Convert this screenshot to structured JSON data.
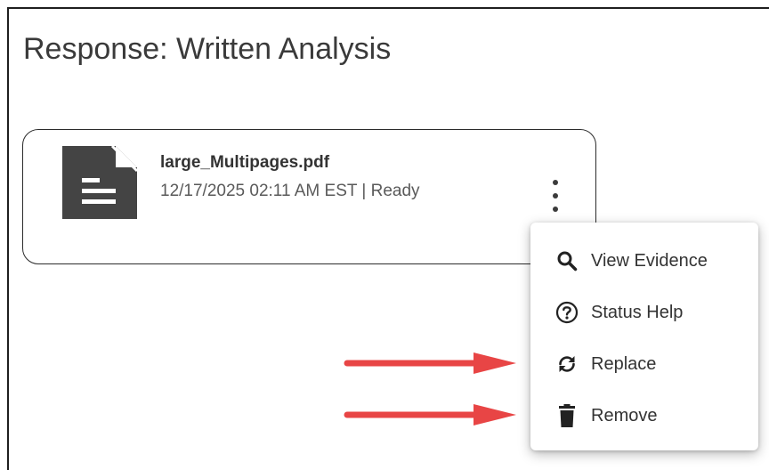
{
  "page": {
    "title": "Response: Written Analysis"
  },
  "file": {
    "name": "large_Multipages.pdf",
    "meta": "12/17/2025 02:11 AM EST | Ready",
    "icon": "document-icon"
  },
  "menu": {
    "items": [
      {
        "label": "View Evidence",
        "icon": "search-icon"
      },
      {
        "label": "Status Help",
        "icon": "help-circle-icon"
      },
      {
        "label": "Replace",
        "icon": "replace-sync-icon"
      },
      {
        "label": "Remove",
        "icon": "trash-icon"
      }
    ]
  },
  "colors": {
    "annotation_arrow": "#e84545",
    "icon_dark": "#444444"
  }
}
